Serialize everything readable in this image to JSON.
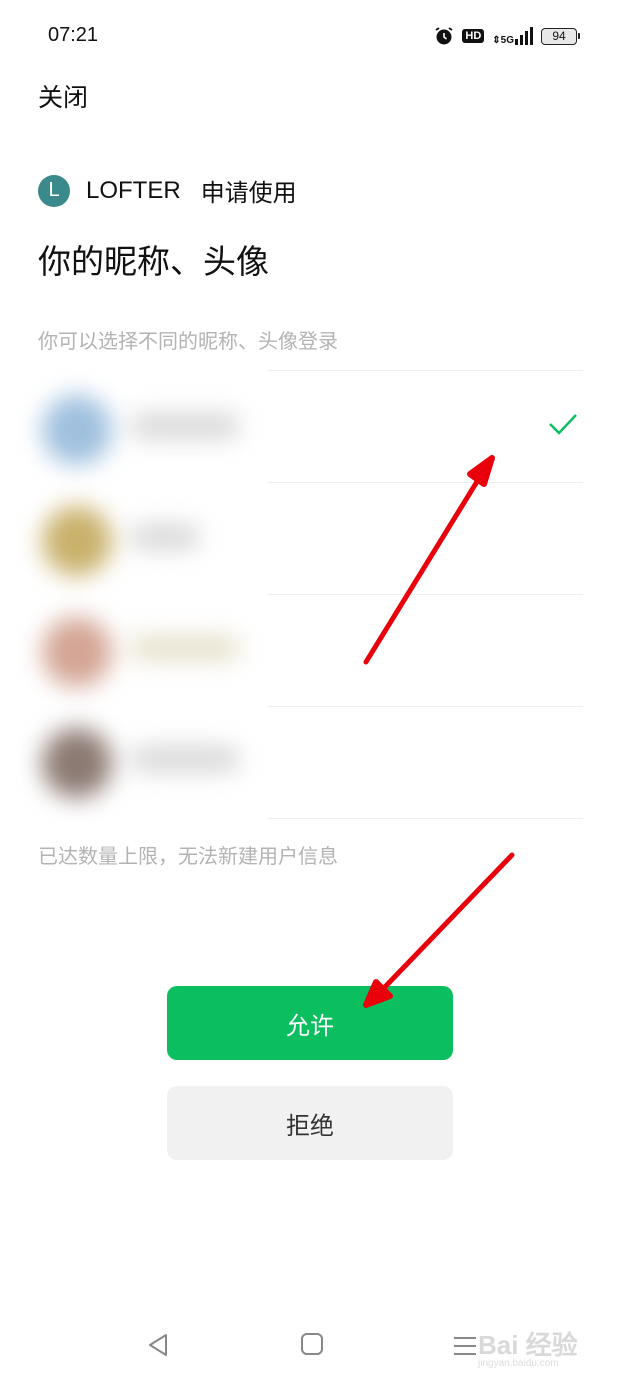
{
  "status_bar": {
    "time": "07:21",
    "icons": [
      "alarm-icon",
      "hd-icon",
      "5g-signal-icon",
      "battery-icon"
    ],
    "hd_label": "HD",
    "network_label": "5G",
    "battery_level": "94"
  },
  "header": {
    "close_label": "关闭"
  },
  "app": {
    "logo_letter": "L",
    "logo_color": "#3b8a8b",
    "name": "LOFTER",
    "request_text": "申请使用"
  },
  "permission": {
    "title": "你的昵称、头像",
    "subtitle": "你可以选择不同的昵称、头像登录",
    "accounts": [
      {
        "avatar_color": "#9fc0de",
        "selected": true
      },
      {
        "avatar_color": "#c9b16b",
        "selected": false
      },
      {
        "avatar_color": "#d4a595",
        "selected": false
      },
      {
        "avatar_color": "#8c7a73",
        "selected": false
      }
    ],
    "limit_note": "已达数量上限，无法新建用户信息"
  },
  "actions": {
    "allow_label": "允许",
    "deny_label": "拒绝",
    "allow_color": "#0bbf60",
    "deny_color": "#f1f1f1"
  },
  "nav_bar": {
    "items": [
      "back-icon",
      "home-icon",
      "menu-icon"
    ]
  },
  "watermark": {
    "brand": "Bai 经验",
    "url": "jingyan.baidu.com"
  },
  "annotations": {
    "arrow_color": "#e8000b"
  }
}
